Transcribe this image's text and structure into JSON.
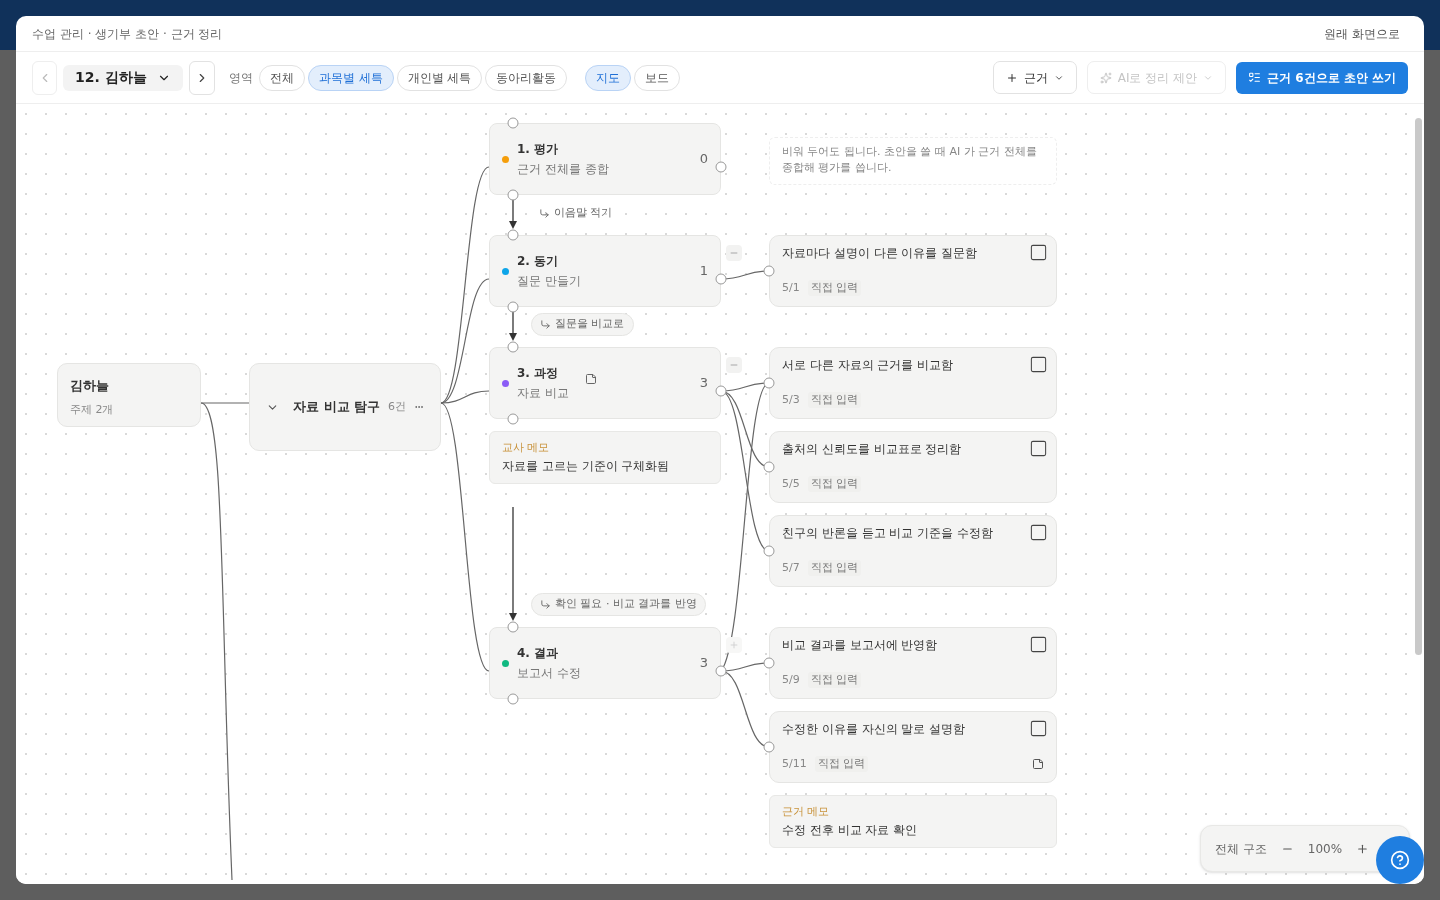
{
  "breadcrumb": "수업 관리 · 생기부 초안 · 근거 정리",
  "back_link": "원래 화면으로",
  "toolbar": {
    "student": "12. 김하늘",
    "area_label": "영역",
    "area_filters": [
      {
        "label": "전체",
        "selected": false
      },
      {
        "label": "과목별 세특",
        "selected": true
      },
      {
        "label": "개인별 세특",
        "selected": false
      },
      {
        "label": "동아리활동",
        "selected": false
      }
    ],
    "view_tabs": [
      {
        "label": "지도",
        "selected": true
      },
      {
        "label": "보드",
        "selected": false
      }
    ],
    "add_button": "근거",
    "ai_button": {
      "label": "AI로 정리 제안",
      "disabled": true
    },
    "draft_button": "근거 6건으로 초안 쓰기"
  },
  "student_node": {
    "name": "김하늘",
    "meta": "주제 2개"
  },
  "topic_node": {
    "title": "자료 비교 탐구",
    "count": "6건",
    "expanded": true
  },
  "steps": [
    {
      "title": "1. 평가",
      "subtitle": "근거 전체를 종합",
      "count": "0",
      "color": "#f59e0b",
      "has_memo": false
    },
    {
      "title": "2. 동기",
      "subtitle": "질문 만들기",
      "count": "1",
      "color": "#0ea5e9",
      "has_memo": false,
      "toggle": {
        "kind": "minus"
      }
    },
    {
      "title": "3. 과정",
      "subtitle": "자료 비교",
      "count": "3",
      "color": "#8b5cf6",
      "has_memo": true,
      "toggle": {
        "kind": "minus"
      }
    },
    {
      "title": "4. 결과",
      "subtitle": "보고서 수정",
      "count": "3",
      "color": "#10b981",
      "has_memo": false,
      "toggle": {
        "kind": "plus"
      }
    }
  ],
  "links": [
    {
      "text": "이음말 적기",
      "kind": "plain"
    },
    {
      "text": "질문을 비교로",
      "kind": "pill"
    },
    {
      "text": "확인 필요 · 비교 결과를 반영",
      "kind": "pill"
    }
  ],
  "teacher_memo": {
    "label": "교사 메모",
    "text": "자료를 고르는 기준이 구체화됨"
  },
  "hint": "비워 두어도 됩니다. 초안을 쓸 때 AI 가 근거 전체를 종합해 평가를 씁니다.",
  "evidence": [
    {
      "text": "자료마다 설명이 다른 이유를 질문함",
      "date": "5/1",
      "source": "직접 입력",
      "checked": false,
      "has_memo": false
    },
    {
      "text": "서로 다른 자료의 근거를 비교함",
      "date": "5/3",
      "source": "직접 입력",
      "checked": false,
      "has_memo": false
    },
    {
      "text": "출처의 신뢰도를 비교표로 정리함",
      "date": "5/5",
      "source": "직접 입력",
      "checked": false,
      "has_memo": false
    },
    {
      "text": "친구의 반론을 듣고 비교 기준을 수정함",
      "date": "5/7",
      "source": "직접 입력",
      "checked": false,
      "has_memo": false
    },
    {
      "text": "비교 결과를 보고서에 반영함",
      "date": "5/9",
      "source": "직접 입력",
      "checked": false,
      "has_memo": false
    },
    {
      "text": "수정한 이유를 자신의 말로 설명함",
      "date": "5/11",
      "source": "직접 입력",
      "checked": false,
      "has_memo": true
    }
  ],
  "evidence_memo": {
    "label": "근거 메모",
    "text": "수정 전후 비교 자료 확인"
  },
  "zoom": {
    "label": "전체 구조",
    "value": "100%"
  }
}
